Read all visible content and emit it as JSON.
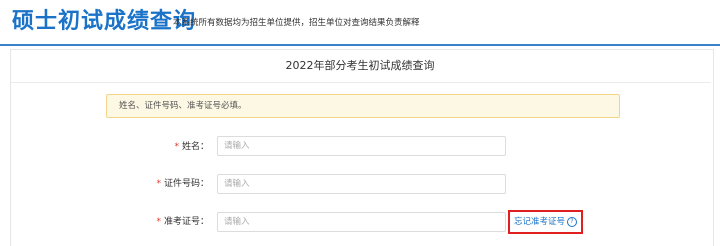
{
  "header": {
    "title": "硕士初试成绩查询",
    "subtitle": "本系统所有数据均为招生单位提供，招生单位对查询结果负责解释"
  },
  "panel": {
    "title": "2022年部分考生初试成绩查询",
    "notice": "姓名、证件号码、准考证号必填。"
  },
  "form": {
    "required_mark": "*",
    "name": {
      "label": "姓名：",
      "placeholder": "请输入"
    },
    "id_number": {
      "label": "证件号码：",
      "placeholder": "请输入"
    },
    "exam_number": {
      "label": "准考证号：",
      "placeholder": "请输入"
    },
    "forgot_link": "忘记准考证号",
    "help_icon_glyph": "?"
  },
  "colors": {
    "accent": "#1a73c8",
    "required": "#e0392b",
    "notice_bg": "#fcf8e3",
    "highlight_border": "#e02020"
  }
}
